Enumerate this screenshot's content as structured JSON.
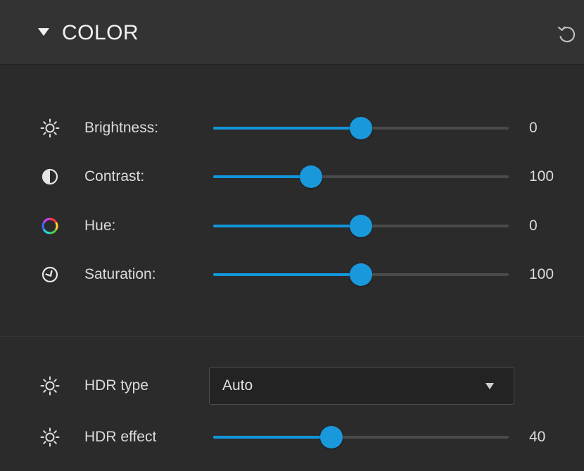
{
  "header": {
    "title": "COLOR",
    "collapse_icon": "triangle-down-icon",
    "reset_icon": "reset-icon"
  },
  "accent_color": "#1296db",
  "adjustments": [
    {
      "label": "Brightness:",
      "icon": "sun-icon",
      "value": "0",
      "fraction": 0.5
    },
    {
      "label": "Contrast:",
      "icon": "contrast-icon",
      "value": "100",
      "fraction": 0.33
    },
    {
      "label": "Hue:",
      "icon": "hue-ring-icon",
      "value": "0",
      "fraction": 0.5
    },
    {
      "label": "Saturation:",
      "icon": "saturation-icon",
      "value": "100",
      "fraction": 0.5
    }
  ],
  "hdr": {
    "type_label": "HDR type",
    "type_icon": "sun-icon",
    "type_value": "Auto",
    "effect_label": "HDR effect",
    "effect_icon": "sun-icon",
    "effect_value": "40",
    "effect_fraction": 0.4
  }
}
